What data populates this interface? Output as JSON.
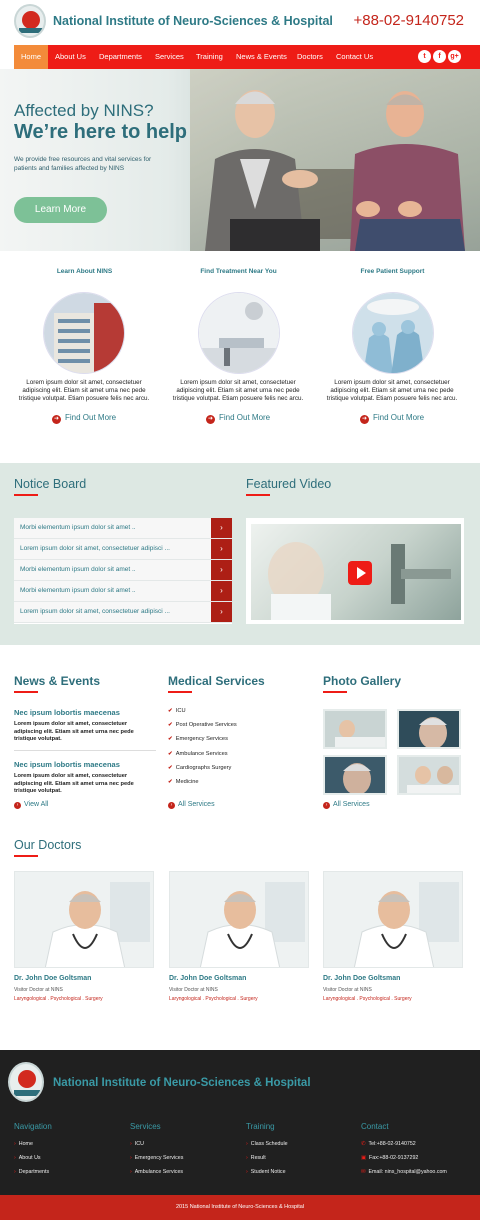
{
  "header": {
    "title": "National Institute of Neuro-Sciences & Hospital",
    "phone": "+88-02-9140752"
  },
  "nav": {
    "items": [
      "Home",
      "About Us",
      "Departments",
      "Services",
      "Training",
      "News & Events",
      "Doctors",
      "Contact Us"
    ],
    "active": "Home",
    "social": [
      "twitter-icon",
      "facebook-icon",
      "google-plus-icon"
    ]
  },
  "hero": {
    "kicker": "Affected by NINS?",
    "title": "We’re here to help",
    "body": "We provide free resources and vital services for patients and families affected by NINS",
    "button": "Learn More"
  },
  "columns": [
    {
      "title": "Learn About NINS",
      "text": "Lorem ipsum dolor sit amet, consectetuer adipiscing elit. Etiam sit amet urna nec pede tristique volutpat. Etiam posuere felis nec arcu.",
      "link": "Find Out More"
    },
    {
      "title": "Find Treatment Near You",
      "text": "Lorem ipsum dolor sit amet, consectetuer adipiscing elit. Etiam sit amet urna nec pede tristique volutpat. Etiam posuere felis nec arcu.",
      "link": "Find Out More"
    },
    {
      "title": "Free Patient Support",
      "text": "Lorem ipsum dolor sit amet, consectetuer adipiscing elit. Etiam sit amet urna nec pede tristique volutpat. Etiam posuere felis nec arcu.",
      "link": "Find Out More"
    }
  ],
  "notice": {
    "heading": "Notice Board",
    "items": [
      "Morbi elementum ipsum dolor sit amet ..",
      "Lorem ipsum dolor sit amet, consectetuer adipisci ...",
      "Morbi elementum ipsum dolor sit amet ..",
      "Morbi elementum ipsum dolor sit amet ..",
      "Lorem ipsum dolor sit amet, consectetuer adipisci ..."
    ]
  },
  "video": {
    "heading": "Featured Video"
  },
  "news": {
    "heading": "News & Events",
    "items": [
      {
        "title": "Nec ipsum lobortis maecenas",
        "text": "Lorem ipsum dolor sit amet, consectetuer adipiscing elit. Etiam sit amet urna nec pede tristique volutpat."
      },
      {
        "title": "Nec ipsum lobortis maecenas",
        "text": "Lorem ipsum dolor sit amet, consectetuer adipiscing elit. Etiam sit amet urna nec pede tristique volutpat."
      }
    ],
    "link": "View All"
  },
  "medical": {
    "heading": "Medical Services",
    "items": [
      "ICU",
      "Post Operative Services",
      "Emergency Services",
      "Ambulance Services",
      "Cardiographs Surgery",
      "Medicine"
    ],
    "link": "All Services"
  },
  "gallery": {
    "heading": "Photo Gallery",
    "link": "All Services"
  },
  "doctors": {
    "heading": "Our Doctors",
    "items": [
      {
        "name": "Dr. John Doe Goltsman",
        "role": "Visitor Doctor at NINS",
        "specialties": "Laryngological . Psychological . Surgery"
      },
      {
        "name": "Dr. John Doe Goltsman",
        "role": "Visitor Doctor at NINS",
        "specialties": "Laryngological . Psychological . Surgery"
      },
      {
        "name": "Dr. John Doe Goltsman",
        "role": "Visitor Doctor at NINS",
        "specialties": "Laryngological . Psychological . Surgery"
      }
    ]
  },
  "footer": {
    "title": "National Institute of Neuro-Sciences & Hospital",
    "navigation": {
      "heading": "Navigation",
      "items": [
        "Home",
        "About Us",
        "Departments"
      ]
    },
    "services": {
      "heading": "Services",
      "items": [
        "ICU",
        "Emergency Services",
        "Ambulance Services"
      ]
    },
    "training": {
      "heading": "Training",
      "items": [
        "Class Schedule",
        "Result",
        "Student Notice"
      ]
    },
    "contact": {
      "heading": "Contact",
      "items": [
        "Tel:+88-02-9140752",
        "Fax:+88-02-9137292",
        "Email: nins_hospital@yahoo.com"
      ]
    },
    "copyright": "2015 National Institute of Neuro-Sciences & Hospital"
  },
  "colors": {
    "accent": "#ee1c16",
    "brand": "#2e6e7b",
    "footer_bg": "#202020",
    "band_bg": "#dde8e3"
  }
}
